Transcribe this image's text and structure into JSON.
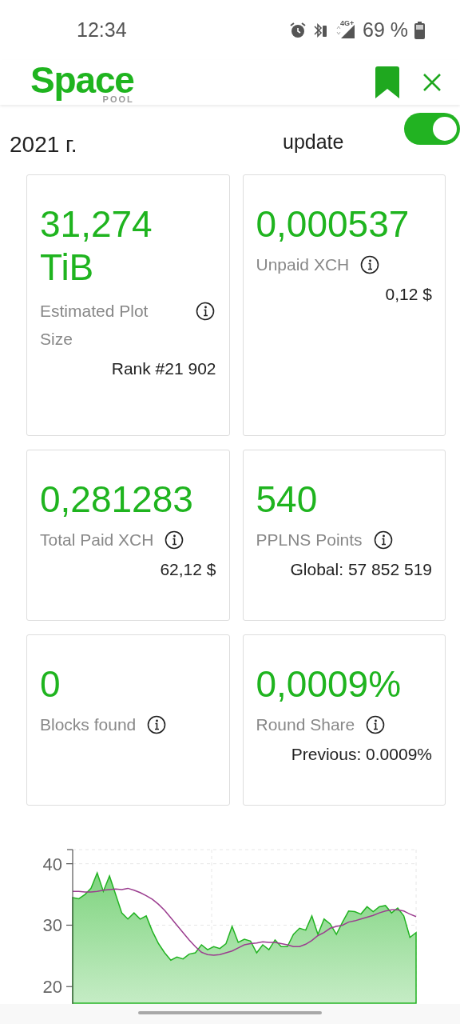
{
  "status_bar": {
    "time": "12:34",
    "network": "4G+",
    "battery": "69 %"
  },
  "header": {
    "logo": "Space",
    "logo_sub": "POOL"
  },
  "member_since": "2021 г.",
  "auto_update": {
    "label": "update",
    "on": true
  },
  "cards": [
    {
      "value": "31,274 TiB",
      "label": "Estimated Plot Size",
      "sub": "Rank #21 902"
    },
    {
      "value": "0,000537",
      "label": "Unpaid XCH",
      "sub": "0,12 $"
    },
    {
      "value": "0,281283",
      "label": "Total Paid XCH",
      "sub": "62,12 $"
    },
    {
      "value": "540",
      "label": "PPLNS Points",
      "sub": "Global: 57 852 519"
    },
    {
      "value": "0",
      "label": "Blocks found"
    },
    {
      "value": "0,0009%",
      "label": "Round Share",
      "sub": "Previous: 0.0009%"
    }
  ],
  "chart": {
    "chart_data": {
      "type": "area",
      "ylim": [
        17.3,
        42.3
      ],
      "yticks": [
        20,
        30,
        40
      ],
      "series": [
        {
          "color": "#22b322",
          "values": [
            34.5,
            34.3,
            35,
            36,
            38.5,
            35.5,
            38,
            35,
            32,
            31,
            32,
            31,
            31.5,
            29,
            27,
            25.5,
            24.3,
            24.8,
            24.5,
            25.3,
            25.5,
            26.8,
            26,
            26.5,
            26.2,
            27,
            29.8,
            27.2,
            27.7,
            27.4,
            25.5,
            26.8,
            26,
            27.6,
            26.5,
            26.5,
            28.5,
            29.5,
            29.2,
            31.5,
            28.5,
            31,
            30.2,
            28.5,
            30.5,
            32.3,
            32.2,
            31.8,
            33,
            32.2,
            33,
            33.2,
            32,
            32.8,
            31.5,
            28,
            28.8
          ]
        },
        {
          "type": "line",
          "color": "#9b3d8f",
          "values": [
            35.5,
            35.5,
            35.4,
            35.4,
            35.5,
            35.7,
            35.8,
            35.9,
            35.8,
            36,
            35.7,
            35.3,
            34.8,
            34.2,
            33.4,
            32.4,
            31.2,
            30,
            28.8,
            27.6,
            26.5,
            25.6,
            25.2,
            25.1,
            25.2,
            25.5,
            25.8,
            26.3,
            26.8,
            27,
            27.1,
            27.3,
            27.2,
            27.2,
            27,
            26.8,
            26.5,
            26.5,
            26.9,
            27.5,
            28.3,
            28.8,
            29.5,
            29.8,
            30,
            30.5,
            30.7,
            31,
            31.3,
            31.6,
            32,
            32.3,
            32.5,
            32.5,
            32.3,
            31.8,
            31.4
          ]
        }
      ]
    }
  }
}
